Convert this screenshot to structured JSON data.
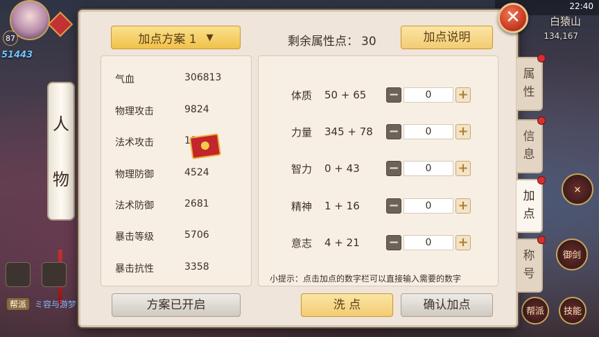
{
  "hud": {
    "clock": "22:40",
    "location": "白猿山",
    "coords": "134,167",
    "level": "87",
    "power": "51443",
    "scroll_char_1": "人",
    "scroll_char_2": "物",
    "guild_tag": "帮派",
    "chat_text": "ミ容与游梦",
    "skill_label_1": "御剑",
    "skill_label_2": "技能",
    "guild_label": "帮派"
  },
  "panel": {
    "scheme_label": "加点方案 1",
    "remaining_label": "剩余属性点：",
    "remaining_value": "30",
    "explain_button": "加点说明",
    "tip": "小提示：点击加点的数字栏可以直接输入需要的数字",
    "scheme_enabled_button": "方案已开启",
    "wash_button": "洗 点",
    "confirm_button": "确认加点"
  },
  "stats": [
    {
      "label": "气血",
      "value": "306813"
    },
    {
      "label": "物理攻击",
      "value": "9824"
    },
    {
      "label": "法术攻击",
      "value": "18"
    },
    {
      "label": "物理防御",
      "value": "4524"
    },
    {
      "label": "法术防御",
      "value": "2681"
    },
    {
      "label": "暴击等级",
      "value": "5706"
    },
    {
      "label": "暴击抗性",
      "value": "3358"
    }
  ],
  "attributes": [
    {
      "name": "体质",
      "value": "50 + 65",
      "input": "0"
    },
    {
      "name": "力量",
      "value": "345 + 78",
      "input": "0"
    },
    {
      "name": "智力",
      "value": "0 + 43",
      "input": "0"
    },
    {
      "name": "精神",
      "value": "1 + 16",
      "input": "0"
    },
    {
      "name": "意志",
      "value": "4 + 21",
      "input": "0"
    }
  ],
  "tabs": [
    {
      "label": "属\n性"
    },
    {
      "label": "信\n息"
    },
    {
      "label": "加\n点"
    },
    {
      "label": "称\n号"
    }
  ],
  "icons": {
    "close": "close-icon",
    "chevron": "chevron-down-icon",
    "minus": "minus-icon",
    "plus": "plus-icon",
    "envelope": "red-envelope-icon"
  }
}
